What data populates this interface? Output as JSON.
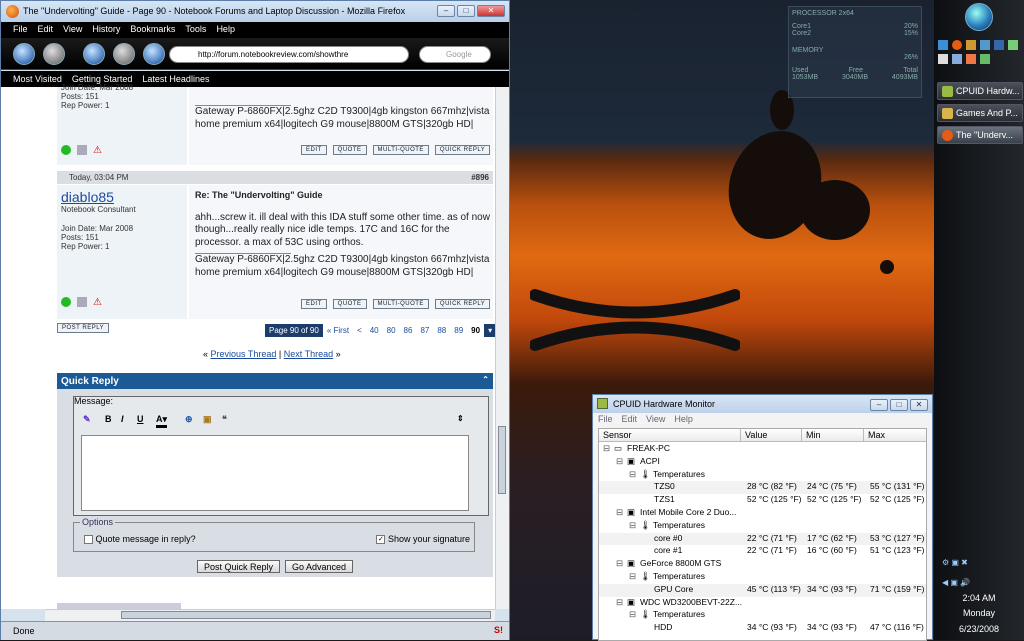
{
  "firefox": {
    "title": "The \"Undervolting\" Guide - Page 90 - Notebook Forums and Laptop Discussion - Mozilla Firefox",
    "menu": [
      "File",
      "Edit",
      "View",
      "History",
      "Bookmarks",
      "Tools",
      "Help"
    ],
    "url": "http://forum.notebookreview.com/showthre",
    "search_placeholder": "Google",
    "bookmarks": [
      "Most Visited",
      "Getting Started",
      "Latest Headlines"
    ],
    "status": "Done"
  },
  "post1": {
    "join_date": "Join Date: Mar 2008",
    "posts": "Posts: 151",
    "rep": "Rep Power: 1",
    "sig": "Gateway P-6860FX|2.5ghz C2D T9300|4gb kingston 667mhz|vista home premium x64|logitech G9 mouse|8800M GTS|320gb HD|"
  },
  "post_buttons": [
    "EDIT",
    "QUOTE",
    "MULTI-QUOTE",
    "QUICK REPLY"
  ],
  "post2": {
    "date": "Today, 03:04 PM",
    "number": "#896",
    "user": "diablo85",
    "rank": "Notebook Consultant",
    "join_date": "Join Date: Mar 2008",
    "posts": "Posts: 151",
    "rep": "Rep Power: 1",
    "subject": "Re: The \"Undervolting\" Guide",
    "body": "ahh...screw it. ill deal with this IDA stuff some other time. as of now though...really really nice idle temps. 17C and 16C for the processor. a max of 53C using orthos.",
    "sig": "Gateway P-6860FX|2.5ghz C2D T9300|4gb kingston 667mhz|vista home premium x64|logitech G9 mouse|8800M GTS|320gb HD|"
  },
  "post_reply": "POST REPLY",
  "pager": {
    "label": "Page 90 of 90",
    "first": "« First",
    "pages": [
      "<",
      "40",
      "80",
      "86",
      "87",
      "88",
      "89",
      "90"
    ]
  },
  "thread_nav": {
    "prev": "Previous Thread",
    "sep": "|",
    "next": "Next Thread"
  },
  "quick_reply": {
    "title": "Quick Reply",
    "message_label": "Message:",
    "options_label": "Options",
    "quote_label": "Quote message in reply?",
    "sig_label": "Show your signature",
    "post_btn": "Post Quick Reply",
    "advanced_btn": "Go Advanced"
  },
  "hwmon": {
    "title": "CPUID Hardware Monitor",
    "menu": [
      "File",
      "Edit",
      "View",
      "Help"
    ],
    "headers": [
      "Sensor",
      "Value",
      "Min",
      "Max"
    ],
    "rows": [
      {
        "indent": 0,
        "name": "FREAK-PC",
        "value": "",
        "min": "",
        "max": ""
      },
      {
        "indent": 1,
        "name": "ACPI",
        "value": "",
        "min": "",
        "max": ""
      },
      {
        "indent": 2,
        "name": "Temperatures",
        "value": "",
        "min": "",
        "max": ""
      },
      {
        "indent": 3,
        "name": "TZS0",
        "value": "28 °C  (82 °F)",
        "min": "24 °C  (75 °F)",
        "max": "55 °C  (131 °F)"
      },
      {
        "indent": 3,
        "name": "TZS1",
        "value": "52 °C  (125 °F)",
        "min": "52 °C  (125 °F)",
        "max": "52 °C  (125 °F)"
      },
      {
        "indent": 1,
        "name": "Intel Mobile Core 2 Duo...",
        "value": "",
        "min": "",
        "max": ""
      },
      {
        "indent": 2,
        "name": "Temperatures",
        "value": "",
        "min": "",
        "max": ""
      },
      {
        "indent": 3,
        "name": "core #0",
        "value": "22 °C  (71 °F)",
        "min": "17 °C  (62 °F)",
        "max": "53 °C  (127 °F)"
      },
      {
        "indent": 3,
        "name": "core #1",
        "value": "22 °C  (71 °F)",
        "min": "16 °C  (60 °F)",
        "max": "51 °C  (123 °F)"
      },
      {
        "indent": 1,
        "name": "GeForce 8800M GTS",
        "value": "",
        "min": "",
        "max": ""
      },
      {
        "indent": 2,
        "name": "Temperatures",
        "value": "",
        "min": "",
        "max": ""
      },
      {
        "indent": 3,
        "name": "GPU Core",
        "value": "45 °C  (113 °F)",
        "min": "34 °C  (93 °F)",
        "max": "71 °C  (159 °F)"
      },
      {
        "indent": 1,
        "name": "WDC WD3200BEVT-22Z...",
        "value": "",
        "min": "",
        "max": ""
      },
      {
        "indent": 2,
        "name": "Temperatures",
        "value": "",
        "min": "",
        "max": ""
      },
      {
        "indent": 3,
        "name": "HDD",
        "value": "34 °C  (93 °F)",
        "min": "34 °C  (93 °F)",
        "max": "47 °C  (116 °F)"
      }
    ]
  },
  "gadget": {
    "processor": "PROCESSOR 2x64",
    "core1": "Core1",
    "core1_pct": "20%",
    "core2": "Core2",
    "core2_pct": "15%",
    "memory": "MEMORY",
    "mem_pct": "26%",
    "used_label": "Used",
    "free_label": "Free",
    "total_label": "Total",
    "used": "1053MB",
    "free": "3040MB",
    "total": "4093MB"
  },
  "taskbar": {
    "buttons": [
      "CPUID Hardw...",
      "Games And P...",
      "The \"Underv..."
    ],
    "time": "2:04 AM",
    "day": "Monday",
    "date": "6/23/2008"
  }
}
